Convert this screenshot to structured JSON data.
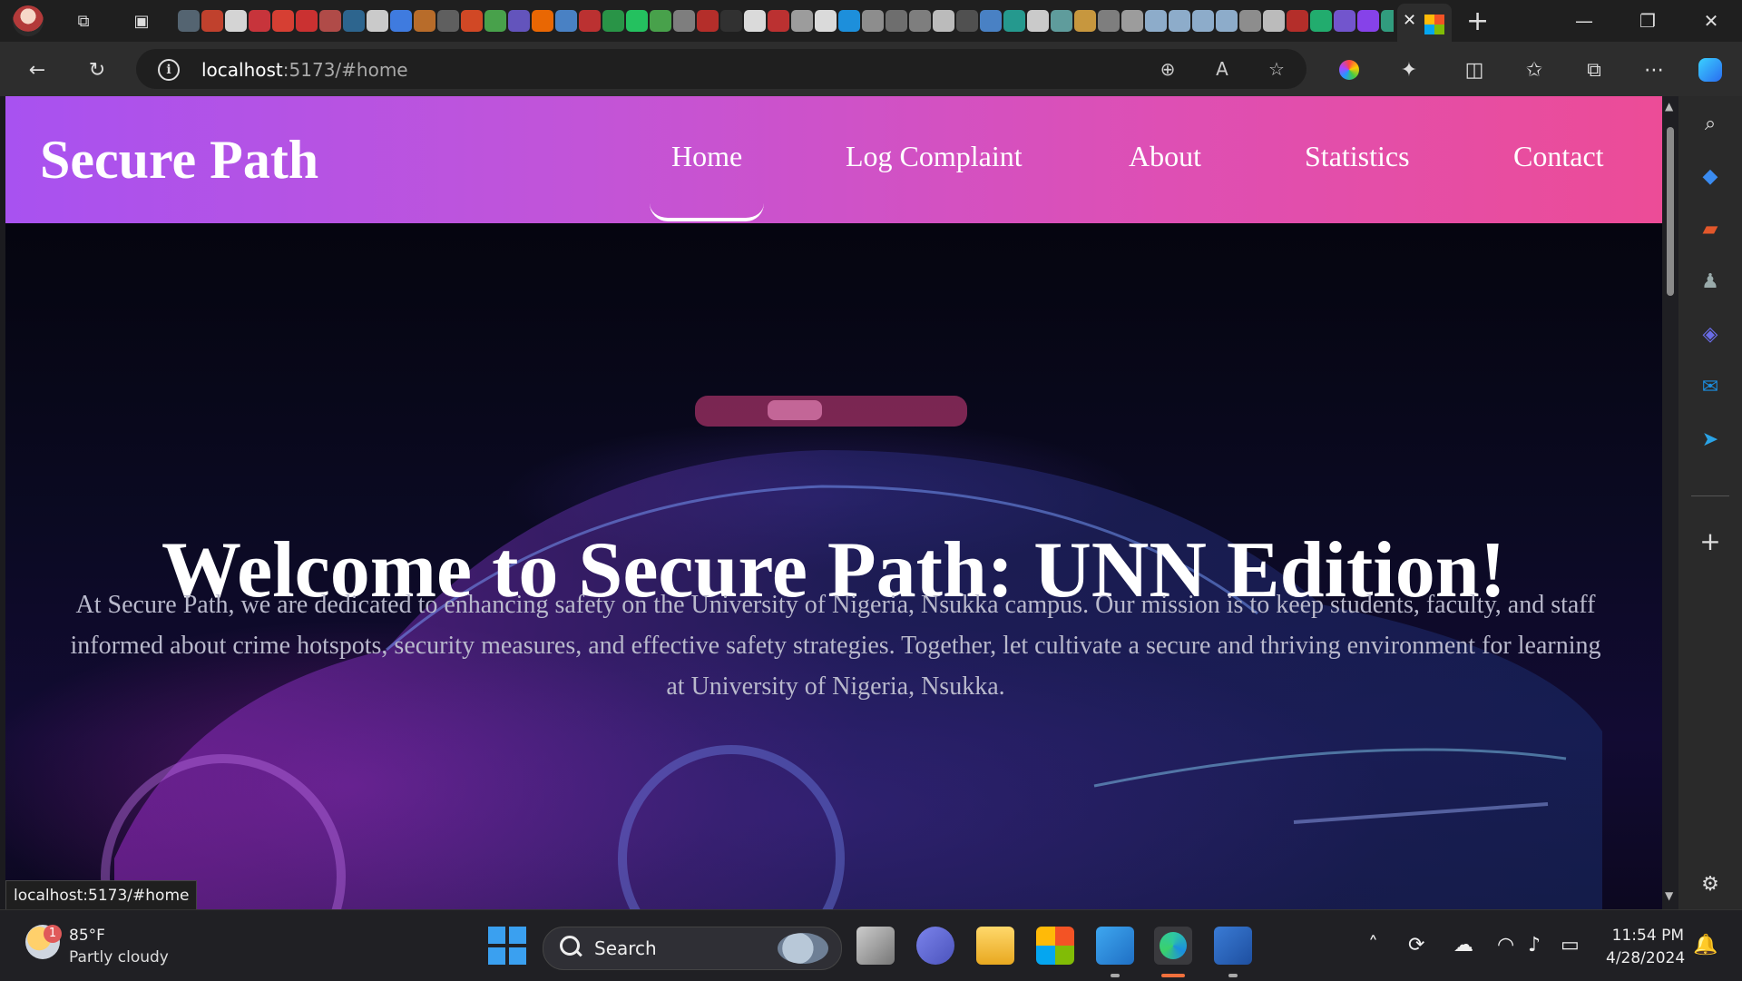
{
  "browser": {
    "url_host": "localhost",
    "url_path": ":5173/#home",
    "status_url": "localhost:5173/#home",
    "favicon_colors": [
      "#5a6b7a",
      "#d2452f",
      "#e8e8e8",
      "#d9363e",
      "#ea4335",
      "#d33",
      "#c0504d",
      "#2f6d9a",
      "#ddd",
      "#4285f4",
      "#c9742b",
      "#666",
      "#e44d26",
      "#4caf50",
      "#6a5acd",
      "#ff6f00",
      "#4e8cd6",
      "#c33",
      "#2aa14b",
      "#25d366",
      "#4caf50",
      "#888",
      "#c4302b",
      "#333",
      "#eee",
      "#c33",
      "#aaa",
      "#eee",
      "#1d9bf0",
      "#999",
      "#777",
      "#888",
      "#ccc",
      "#555",
      "#4e8cd6",
      "#26a69a",
      "#ddd",
      "#6aa",
      "#d9a441",
      "#888",
      "#aaa",
      "#9bd",
      "#9bd",
      "#9bd",
      "#9bd",
      "#999",
      "#ccc",
      "#c4302b",
      "#2b7",
      "#7b5be0",
      "#9146ff",
      "#3a8",
      "#3a7bd5"
    ]
  },
  "site": {
    "brand": "Secure Path",
    "nav": [
      {
        "label": "Home",
        "active": true
      },
      {
        "label": "Log Complaint"
      },
      {
        "label": "About"
      },
      {
        "label": "Statistics"
      },
      {
        "label": "Contact"
      }
    ],
    "accent_gradient": [
      "#a852f0",
      "#ec4c97"
    ]
  },
  "hero": {
    "title": "Welcome to Secure Path: UNN Edition!",
    "text": "At Secure Path, we are dedicated to enhancing safety on the University of Nigeria, Nsukka campus. Our mission is to keep students, faculty, and staff informed about crime hotspots, security measures, and effective safety strategies. Together, let cultivate a secure and thriving environment for learning at University of Nigeria, Nsukka."
  },
  "taskbar": {
    "weather_temp": "85°F",
    "weather_desc": "Partly cloudy",
    "weather_badge": "1",
    "search_label": "Search",
    "time": "11:54 PM",
    "date": "4/28/2024"
  }
}
